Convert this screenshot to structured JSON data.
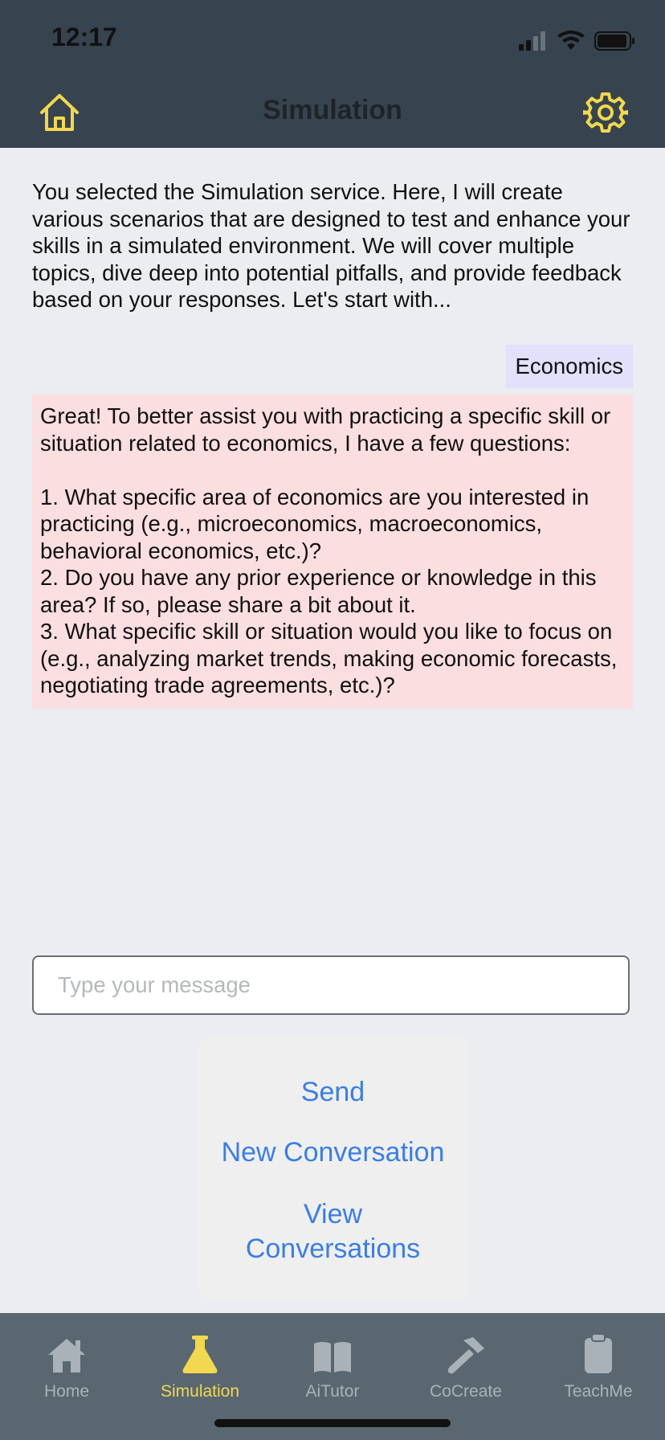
{
  "status": {
    "time": "12:17"
  },
  "header": {
    "title": "Simulation",
    "home_icon": "home-icon",
    "settings_icon": "gear-icon"
  },
  "chat": {
    "intro": "You selected the Simulation service. Here, I will create various scenarios that are designed to test and enhance your skills in a simulated environment. We will cover multiple topics, dive deep into potential pitfalls, and provide feedback based on your responses. Let's start with...",
    "user_message": "Economics",
    "bot_message": "Great! To better assist you with practicing a specific skill or situation related to economics, I have a few questions:\n\n1. What specific area of economics are you interested in practicing (e.g., microeconomics, macroeconomics, behavioral economics, etc.)?\n2. Do you have any prior experience or knowledge in this area? If so, please share a bit about it.\n3. What specific skill or situation would you like to focus on (e.g., analyzing market trends, making economic forecasts, negotiating trade agreements, etc.)?"
  },
  "composer": {
    "placeholder": "Type your message",
    "value": ""
  },
  "actions": {
    "send": "Send",
    "new_conversation": "New Conversation",
    "view_conversations": "View Conversations"
  },
  "tabs": [
    {
      "label": "Home",
      "icon": "house-icon",
      "active": false
    },
    {
      "label": "Simulation",
      "icon": "flask-icon",
      "active": true
    },
    {
      "label": "AiTutor",
      "icon": "book-icon",
      "active": false
    },
    {
      "label": "CoCreate",
      "icon": "hammer-icon",
      "active": false
    },
    {
      "label": "TeachMe",
      "icon": "clipboard-icon",
      "active": false
    }
  ],
  "colors": {
    "header_bg": "#37444f",
    "accent_yellow": "#f2d84f",
    "link_blue": "#3b7ee3",
    "user_bubble": "#e2e0fb",
    "bot_bubble": "#fbdee0",
    "tabbar_bg": "#5a6771"
  }
}
